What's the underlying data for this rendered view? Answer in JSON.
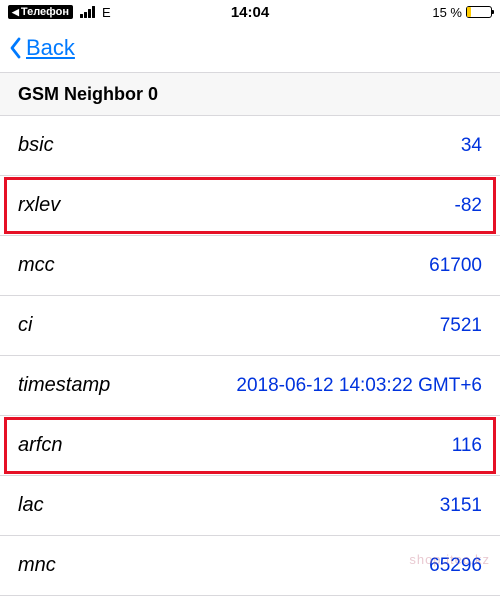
{
  "status_bar": {
    "return_app": "Телефон",
    "network": "E",
    "time": "14:04",
    "battery_pct": "15 %"
  },
  "nav": {
    "back_label": "Back"
  },
  "section": {
    "title": "GSM Neighbor 0"
  },
  "rows": [
    {
      "label": "bsic",
      "value": "34",
      "highlight": false
    },
    {
      "label": "rxlev",
      "value": "-82",
      "highlight": true
    },
    {
      "label": "mcc",
      "value": "61700",
      "highlight": false
    },
    {
      "label": "ci",
      "value": "7521",
      "highlight": false
    },
    {
      "label": "timestamp",
      "value": "2018-06-12 14:03:22 GMT+6",
      "highlight": false
    },
    {
      "label": "arfcn",
      "value": "116",
      "highlight": true
    },
    {
      "label": "lac",
      "value": "3151",
      "highlight": false
    },
    {
      "label": "mnc",
      "value": "65296",
      "highlight": false
    }
  ],
  "watermark": "shop.itec.kz"
}
